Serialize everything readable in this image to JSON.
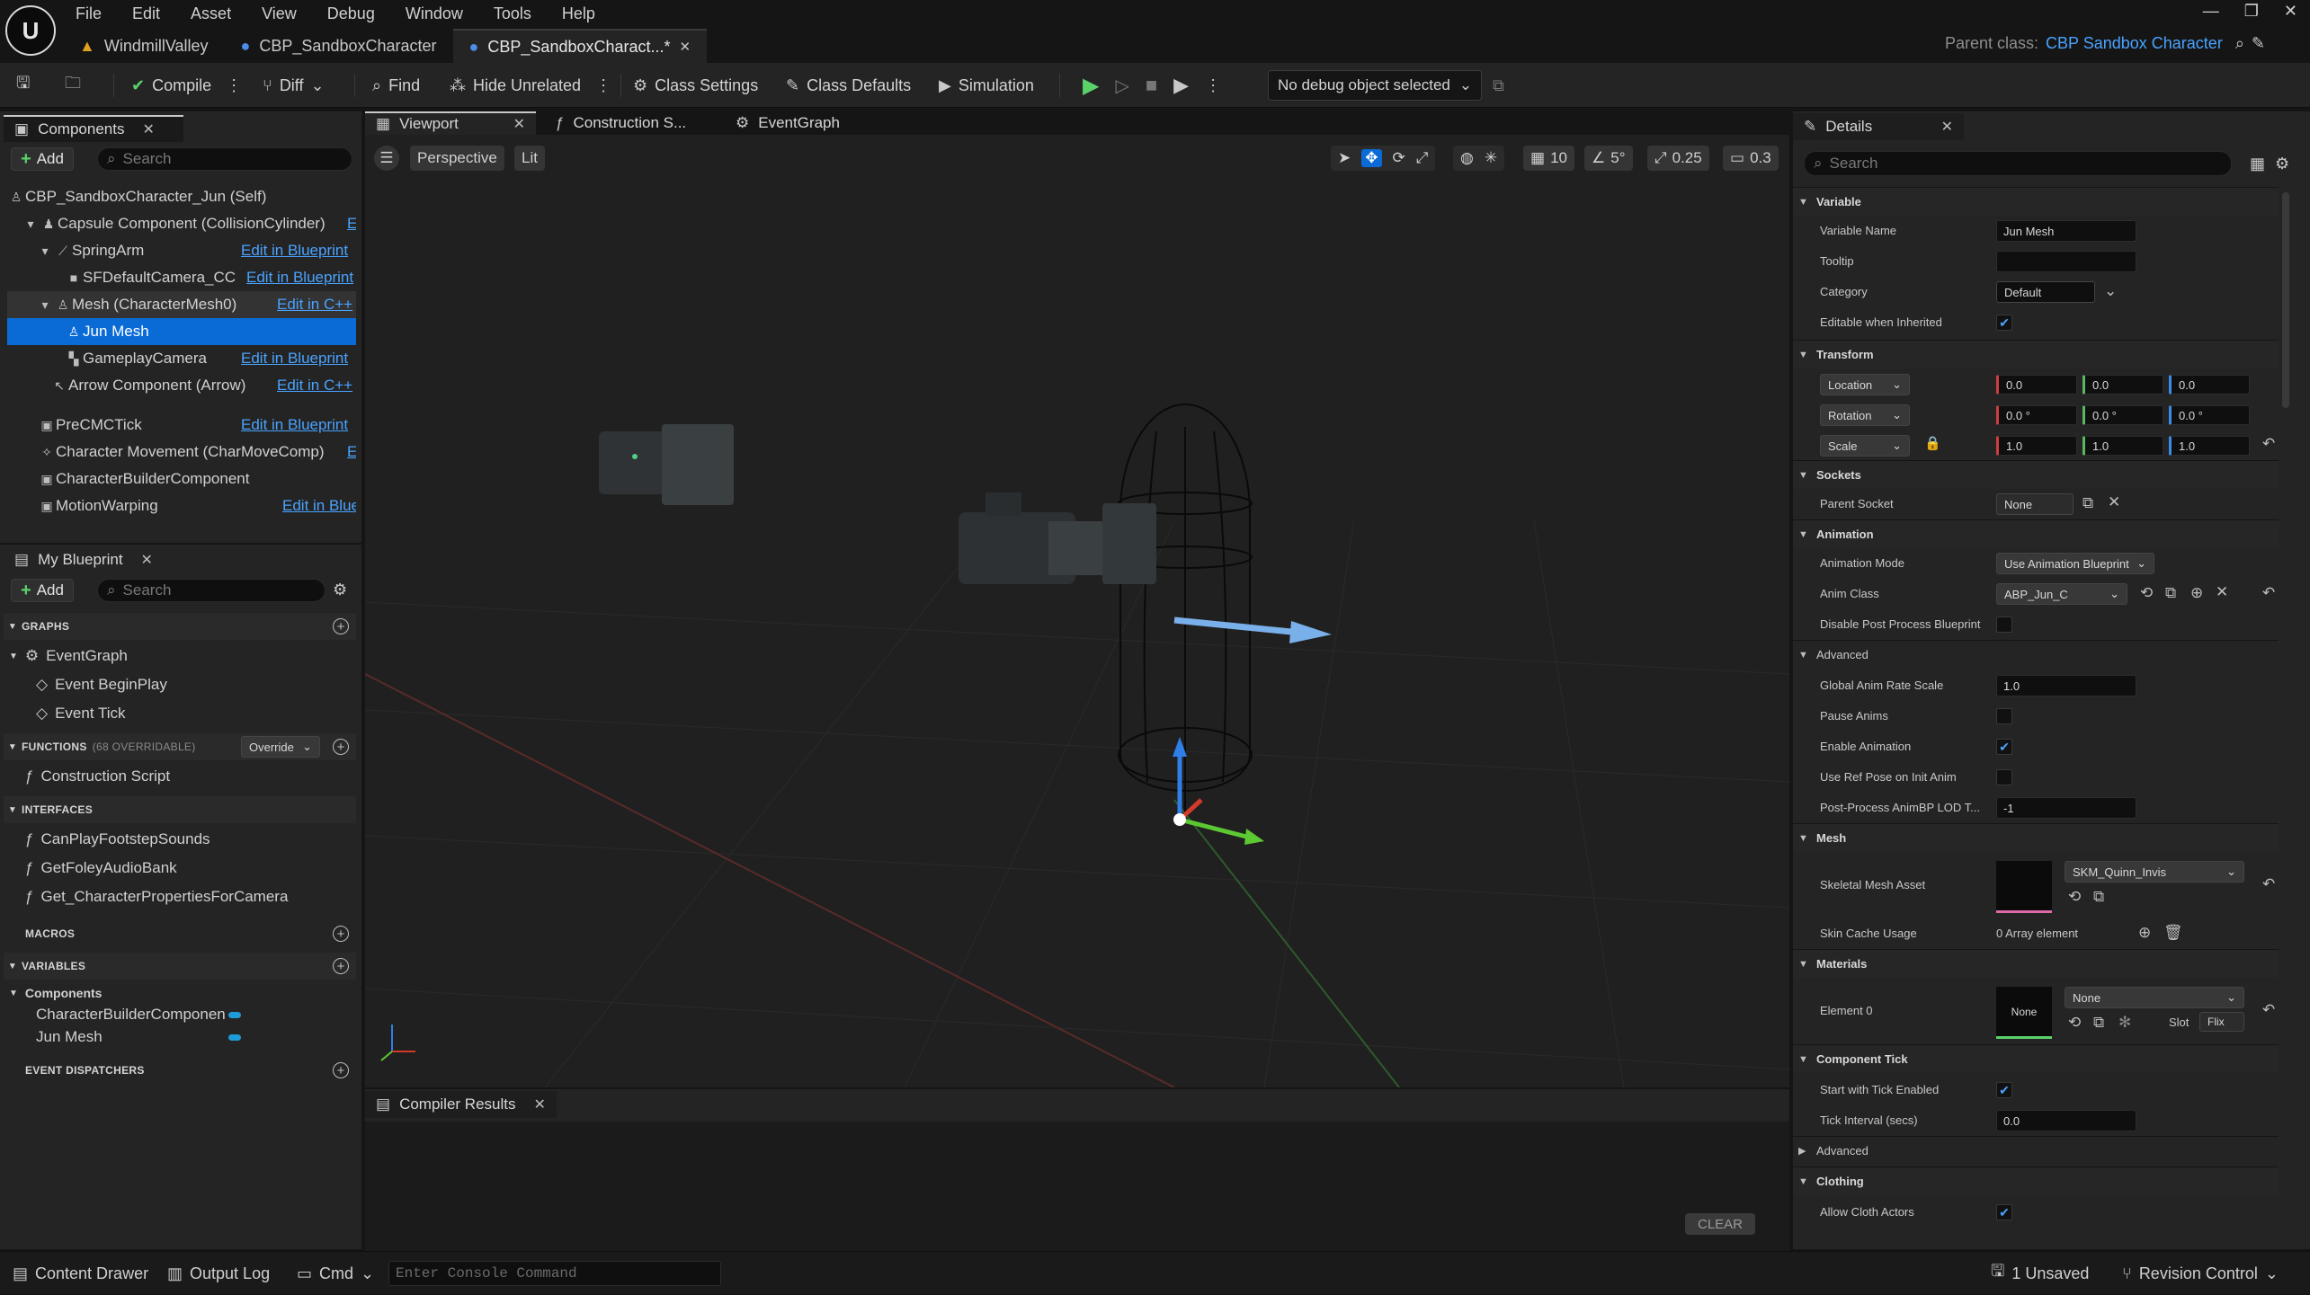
{
  "menu": [
    "File",
    "Edit",
    "Asset",
    "View",
    "Debug",
    "Window",
    "Tools",
    "Help"
  ],
  "doc_tabs": {
    "t1": "WindmillValley",
    "t2": "CBP_SandboxCharacter",
    "t3": "CBP_SandboxCharact...*"
  },
  "parent_class": {
    "label": "Parent class:",
    "value": "CBP Sandbox Character"
  },
  "toolbar": {
    "compile": "Compile",
    "diff": "Diff",
    "find": "Find",
    "hide_unrelated": "Hide Unrelated",
    "class_settings": "Class Settings",
    "class_defaults": "Class Defaults",
    "simulation": "Simulation",
    "debug_object": "No debug object selected"
  },
  "components": {
    "tab": "Components",
    "add": "Add",
    "search_placeholder": "Search",
    "rows": [
      {
        "label": "CBP_SandboxCharacter_Jun (Self)"
      },
      {
        "label": "Capsule Component (CollisionCylinder)",
        "link": "E"
      },
      {
        "label": "SpringArm",
        "link": "Edit in Blueprint"
      },
      {
        "label": "SFDefaultCamera_CC",
        "link": "Edit in Blueprint"
      },
      {
        "label": "Mesh (CharacterMesh0)",
        "link": "Edit in C++"
      },
      {
        "label": "Jun Mesh"
      },
      {
        "label": "GameplayCamera",
        "link": "Edit in Blueprint"
      },
      {
        "label": "Arrow Component (Arrow)",
        "link": "Edit in C++"
      },
      {
        "label": "PreCMCTick",
        "link": "Edit in Blueprint"
      },
      {
        "label": "Character Movement (CharMoveComp)",
        "link": "E"
      },
      {
        "label": "CharacterBuilderComponent"
      },
      {
        "label": "MotionWarping",
        "link": "Edit in Blueprint"
      }
    ]
  },
  "my_blueprint": {
    "tab": "My Blueprint",
    "add": "Add",
    "search_placeholder": "Search",
    "graphs_header": "GRAPHS",
    "event_graph": "EventGraph",
    "begin_play": "Event BeginPlay",
    "tick": "Event Tick",
    "functions_header": "FUNCTIONS",
    "functions_count": "(68 OVERRIDABLE)",
    "override": "Override",
    "construction": "Construction Script",
    "interfaces_header": "INTERFACES",
    "interfaces": [
      "CanPlayFootstepSounds",
      "GetFoleyAudioBank",
      "Get_CharacterPropertiesForCamera"
    ],
    "macros_header": "MACROS",
    "variables_header": "VARIABLES",
    "var_group": "Components",
    "variables": [
      "CharacterBuilderComponen",
      "Jun Mesh"
    ],
    "dispatchers_header": "EVENT DISPATCHERS"
  },
  "center_tabs": {
    "viewport": "Viewport",
    "construction": "Construction S...",
    "eventgraph": "EventGraph"
  },
  "viewport": {
    "perspective": "Perspective",
    "lit": "Lit",
    "grid": "10",
    "angle": "5°",
    "scale": "0.25",
    "cam": "0.3"
  },
  "compiler": {
    "tab": "Compiler Results",
    "clear": "CLEAR"
  },
  "details": {
    "tab": "Details",
    "search_placeholder": "Search",
    "sections": {
      "variable": "Variable",
      "transform": "Transform",
      "sockets": "Sockets",
      "animation": "Animation",
      "advanced": "Advanced",
      "mesh": "Mesh",
      "materials": "Materials",
      "component_tick": "Component Tick",
      "advanced2": "Advanced",
      "clothing": "Clothing"
    },
    "labels": {
      "variable_name": "Variable Name",
      "tooltip": "Tooltip",
      "category": "Category",
      "editable": "Editable when Inherited",
      "parent_socket": "Parent Socket",
      "anim_mode": "Animation Mode",
      "anim_class": "Anim Class",
      "disable_pp": "Disable Post Process Blueprint",
      "global_rate": "Global Anim Rate Scale",
      "pause_anims": "Pause Anims",
      "enable_anim": "Enable Animation",
      "ref_pose": "Use Ref Pose on Init Anim",
      "pp_lod": "Post-Process AnimBP LOD T...",
      "skel_mesh": "Skeletal Mesh Asset",
      "skin_cache": "Skin Cache Usage",
      "element0": "Element 0",
      "start_tick": "Start with Tick Enabled",
      "tick_interval": "Tick Interval (secs)",
      "allow_cloth": "Allow Cloth Actors",
      "slot": "Slot"
    },
    "values": {
      "variable_name": "Jun Mesh",
      "tooltip": "",
      "category": "Default",
      "location": "Location",
      "rotation": "Rotation",
      "scale": "Scale",
      "loc": [
        "0.0",
        "0.0",
        "0.0"
      ],
      "rot": [
        "0.0 °",
        "0.0 °",
        "0.0 °"
      ],
      "scl": [
        "1.0",
        "1.0",
        "1.0"
      ],
      "parent_socket": "None",
      "anim_mode": "Use Animation Blueprint",
      "anim_class": "ABP_Jun_C",
      "global_rate": "1.0",
      "pp_lod": "-1",
      "skel_mesh": "SKM_Quinn_Invis",
      "skin_cache": "0 Array element",
      "element0": "None",
      "element0_thumb": "None",
      "slot_value": "Flix",
      "tick_interval": "0.0"
    }
  },
  "status": {
    "content_drawer": "Content Drawer",
    "output_log": "Output Log",
    "cmd": "Cmd",
    "console_placeholder": "Enter Console Command",
    "unsaved": "1 Unsaved",
    "revision": "Revision Control"
  }
}
